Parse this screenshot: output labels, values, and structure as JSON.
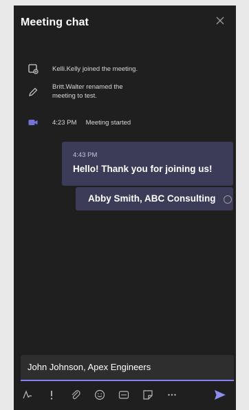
{
  "panel": {
    "title": "Meeting chat",
    "close_icon": "close-icon"
  },
  "system_messages": [
    {
      "icon": "participant-joined-icon",
      "text": "Kelli.Kelly joined the meeting."
    },
    {
      "icon": "pencil-icon",
      "line1": "Britt.Walter renamed the",
      "line2": "meeting to test."
    },
    {
      "icon": "video-camera-icon",
      "time": "4:23 PM",
      "text": "Meeting started"
    }
  ],
  "messages": [
    {
      "time": "4:43 PM",
      "text": "Hello! Thank you for joining us!"
    },
    {
      "text": "Abby Smith, ABC Consulting"
    }
  ],
  "compose": {
    "value": "John Johnson, Apex Engineers"
  },
  "toolbar": {
    "icons": [
      "format-icon",
      "priority-icon",
      "attach-icon",
      "emoji-icon",
      "giphy-icon",
      "sticker-icon",
      "more-options-icon",
      "send-icon"
    ]
  },
  "colors": {
    "panel_bg": "#1f1f1f",
    "bubble_bg": "#3b3c58",
    "accent": "#7f85f5"
  }
}
